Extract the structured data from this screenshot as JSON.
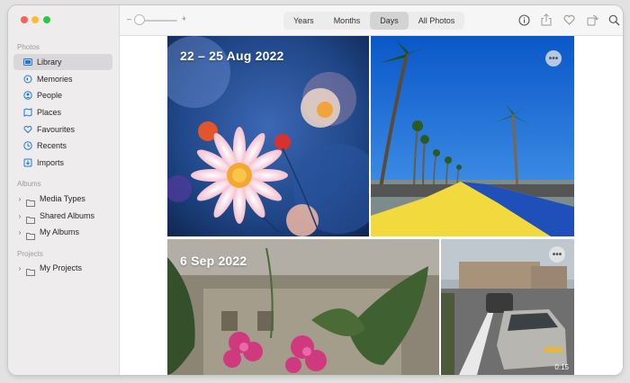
{
  "window": {
    "controls": [
      "close",
      "minimize",
      "zoom"
    ]
  },
  "sidebar": {
    "photos_header": "Photos",
    "items": [
      {
        "label": "Library",
        "icon": "library-icon",
        "active": true
      },
      {
        "label": "Memories",
        "icon": "memories-icon"
      },
      {
        "label": "People",
        "icon": "people-icon"
      },
      {
        "label": "Places",
        "icon": "places-icon"
      },
      {
        "label": "Favourites",
        "icon": "heart-icon"
      },
      {
        "label": "Recents",
        "icon": "clock-icon"
      },
      {
        "label": "Imports",
        "icon": "import-icon"
      }
    ],
    "albums_header": "Albums",
    "album_groups": [
      {
        "label": "Media Types"
      },
      {
        "label": "Shared Albums"
      },
      {
        "label": "My Albums"
      }
    ],
    "projects_header": "Projects",
    "project_groups": [
      {
        "label": "My Projects"
      }
    ]
  },
  "toolbar": {
    "zoom_minus": "–",
    "zoom_plus": "+",
    "zoom_level": 0.0,
    "views": [
      "Years",
      "Months",
      "Days",
      "All Photos"
    ],
    "active_view": "Days",
    "icons": [
      "info-icon",
      "share-icon",
      "favourite-icon",
      "rotate-icon",
      "search-icon"
    ]
  },
  "content": {
    "day1_title": "22 – 25 Aug 2022",
    "day2_title": "6 Sep 2022",
    "video_duration": "0:15",
    "more_glyph": "•••"
  }
}
